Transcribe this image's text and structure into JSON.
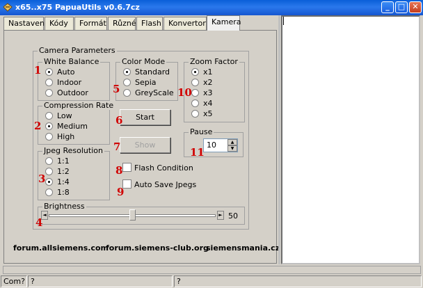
{
  "window": {
    "title": "x65..x75 PapuaUtils v0.6.7cz",
    "minimize": "_",
    "maximize": "□",
    "close": "✕"
  },
  "tabs": [
    "Nastavení",
    "Kódy",
    "Formát",
    "Různé",
    "Flash",
    "Konvertor",
    "Kamera"
  ],
  "camera": {
    "title": "Camera Parameters",
    "white_balance": {
      "title": "White Balance",
      "options": [
        "Auto",
        "Indoor",
        "Outdoor"
      ]
    },
    "compression": {
      "title": "Compression Rate",
      "options": [
        "Low",
        "Medium",
        "High"
      ]
    },
    "resolution": {
      "title": "Jpeg Resolution",
      "options": [
        "1:1",
        "1:2",
        "1:4",
        "1:8"
      ]
    },
    "color_mode": {
      "title": "Color Mode",
      "options": [
        "Standard",
        "Sepia",
        "GreyScale"
      ]
    },
    "zoom": {
      "title": "Zoom Factor",
      "options": [
        "x1",
        "x2",
        "x3",
        "x4",
        "x5"
      ]
    },
    "start_label": "Start",
    "show_label": "Show",
    "pause": {
      "title": "Pause",
      "value": "10"
    },
    "flash_condition": "Flash Condition",
    "auto_save": "Auto Save Jpegs",
    "brightness": {
      "title": "Brightness",
      "value": "50",
      "level": 50
    }
  },
  "markers": [
    "1",
    "2",
    "3",
    "4",
    "5",
    "6",
    "7",
    "8",
    "9",
    "10",
    "11"
  ],
  "links": [
    "forum.allsiemens.com",
    "forum.siemens-club.org",
    "siemensmania.cz"
  ],
  "statusbar": [
    "Com?",
    "?",
    "?"
  ]
}
